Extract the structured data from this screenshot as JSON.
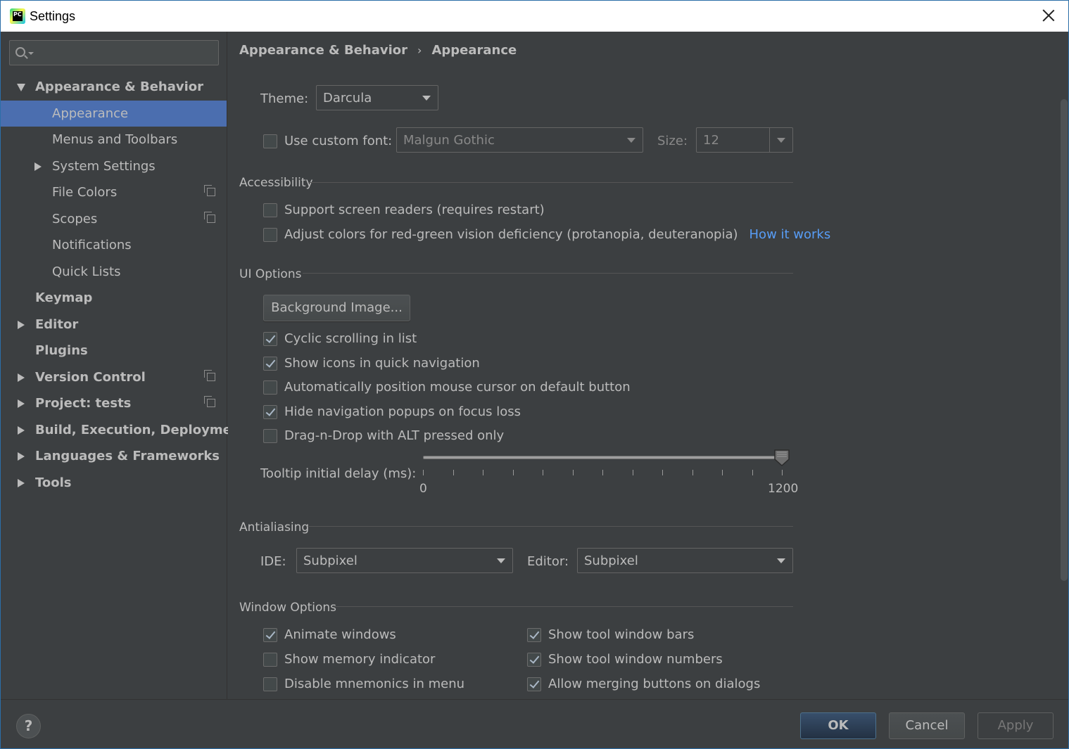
{
  "window": {
    "title": "Settings"
  },
  "search": {
    "placeholder": ""
  },
  "sidebar": {
    "items": [
      {
        "label": "Appearance & Behavior"
      },
      {
        "label": "Appearance"
      },
      {
        "label": "Menus and Toolbars"
      },
      {
        "label": "System Settings"
      },
      {
        "label": "File Colors"
      },
      {
        "label": "Scopes"
      },
      {
        "label": "Notifications"
      },
      {
        "label": "Quick Lists"
      },
      {
        "label": "Keymap"
      },
      {
        "label": "Editor"
      },
      {
        "label": "Plugins"
      },
      {
        "label": "Version Control"
      },
      {
        "label": "Project: tests"
      },
      {
        "label": "Build, Execution, Deployment"
      },
      {
        "label": "Languages & Frameworks"
      },
      {
        "label": "Tools"
      }
    ]
  },
  "breadcrumb": {
    "parent": "Appearance & Behavior",
    "separator": "›",
    "current": "Appearance"
  },
  "theme": {
    "label": "Theme:",
    "value": "Darcula"
  },
  "custom_font": {
    "label": "Use custom font:",
    "checked": false,
    "font_value": "Malgun Gothic",
    "size_label": "Size:",
    "size_value": "12"
  },
  "accessibility": {
    "title": "Accessibility",
    "screen_readers": {
      "label": "Support screen readers (requires restart)",
      "checked": false
    },
    "color_adjust": {
      "label": "Adjust colors for red-green vision deficiency (protanopia, deuteranopia)",
      "checked": false
    },
    "how_it_works": "How it works"
  },
  "ui_options": {
    "title": "UI Options",
    "background_button": "Background Image...",
    "cyclic": {
      "label": "Cyclic scrolling in list",
      "checked": true
    },
    "show_icons": {
      "label": "Show icons in quick navigation",
      "checked": true
    },
    "auto_position": {
      "label": "Automatically position mouse cursor on default button",
      "checked": false
    },
    "hide_popups": {
      "label": "Hide navigation popups on focus loss",
      "checked": true
    },
    "drag_drop": {
      "label": "Drag-n-Drop with ALT pressed only",
      "checked": false
    },
    "tooltip": {
      "label": "Tooltip initial delay (ms):",
      "min": "0",
      "max": "1200",
      "value": 1200
    }
  },
  "antialiasing": {
    "title": "Antialiasing",
    "ide_label": "IDE:",
    "ide_value": "Subpixel",
    "editor_label": "Editor:",
    "editor_value": "Subpixel"
  },
  "window_options": {
    "title": "Window Options",
    "animate": {
      "label": "Animate windows",
      "checked": true
    },
    "memory": {
      "label": "Show memory indicator",
      "checked": false
    },
    "mnemonics": {
      "label": "Disable mnemonics in menu",
      "checked": false
    },
    "tool_bars": {
      "label": "Show tool window bars",
      "checked": true
    },
    "tool_numbers": {
      "label": "Show tool window numbers",
      "checked": true
    },
    "merging": {
      "label": "Allow merging buttons on dialogs",
      "checked": true
    }
  },
  "footer": {
    "help": "?",
    "ok": "OK",
    "cancel": "Cancel",
    "apply": "Apply"
  }
}
